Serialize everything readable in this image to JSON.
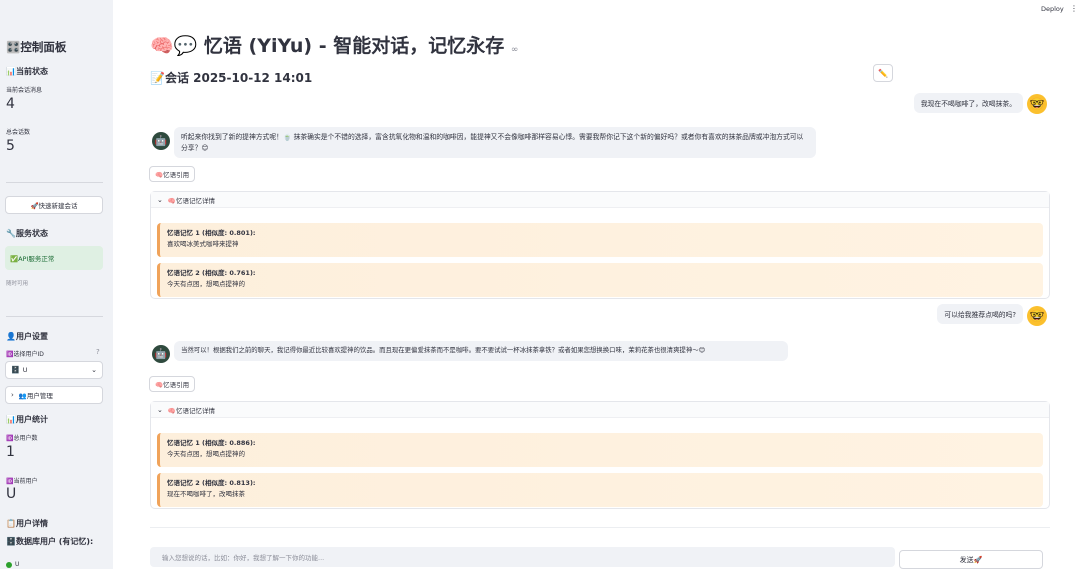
{
  "header": {
    "deploy_label": "Deploy",
    "menu_icon": "⋮"
  },
  "sidebar": {
    "title": "🎛️控制面板",
    "current_status_heading": "📊当前状态",
    "session_messages_label": "当前会话消息",
    "session_messages_value": "4",
    "total_sessions_label": "总会话数",
    "total_sessions_value": "5",
    "new_session_button": "🚀快速新建会话",
    "service_status_heading": "🔧服务状态",
    "api_status": "✅API服务正常",
    "available_note": "随时可用",
    "user_settings_heading": "👤用户设置",
    "select_user_label": "🆔选择用户ID",
    "selected_user": "U",
    "user_management_label": "👥用户管理",
    "user_stats_heading": "📊用户统计",
    "total_users_label": "🆔总用户数",
    "total_users_value": "1",
    "current_user_label": "🆔当前用户",
    "current_user_value": "U",
    "user_details_heading": "📋用户详情",
    "db_users_heading": "🗄️数据库用户 (有记忆):",
    "db_user_first": "U"
  },
  "main": {
    "title": "🧠💬 忆语 (YiYu) - 智能对话，记忆永存",
    "title_link_icon": "∞",
    "session_title": "📝会话 2025-10-12 14:01",
    "edit_icon": "✏️",
    "messages": [
      {
        "role": "user",
        "text": "我现在不喝咖啡了，改喝抹茶。"
      },
      {
        "role": "assistant",
        "text": "听起来你找到了新的提神方式呢！🍵 抹茶确实是个不错的选择，富含抗氧化物和温和的咖啡因，能提神又不会像咖啡那样容易心悸。需要我帮你记下这个新的偏好吗？或者你有喜欢的抹茶品牌或冲泡方式可以分享？😊"
      },
      {
        "role": "user",
        "text": "可以给我推荐点喝的吗?"
      },
      {
        "role": "assistant",
        "text": "当然可以！根据我们之前的聊天，我记得你最近比较喜欢提神的饮品。而且现在更偏爱抹茶而不是咖啡。要不要试试一杯冰抹茶拿铁？或者如果您想换换口味，茉莉花茶也很清爽提神～😊"
      }
    ],
    "cite_label": "🧠忆语引用",
    "memory_details_label": "🧠忆语记忆详情",
    "memory_groups": [
      [
        {
          "title": "忆语记忆 1 (相似度: 0.801):",
          "text": "喜欢喝冰美式咖啡来提神"
        },
        {
          "title": "忆语记忆 2 (相似度: 0.761):",
          "text": "今天有点困，想喝点提神的"
        }
      ],
      [
        {
          "title": "忆语记忆 1 (相似度: 0.886):",
          "text": "今天有点困，想喝点提神的"
        },
        {
          "title": "忆语记忆 2 (相似度: 0.813):",
          "text": "现在不喝咖啡了，改喝抹茶"
        }
      ]
    ],
    "input_placeholder": "输入您想说的话，比如：你好，我想了解一下你的功能...",
    "send_label": "发送🚀"
  }
}
